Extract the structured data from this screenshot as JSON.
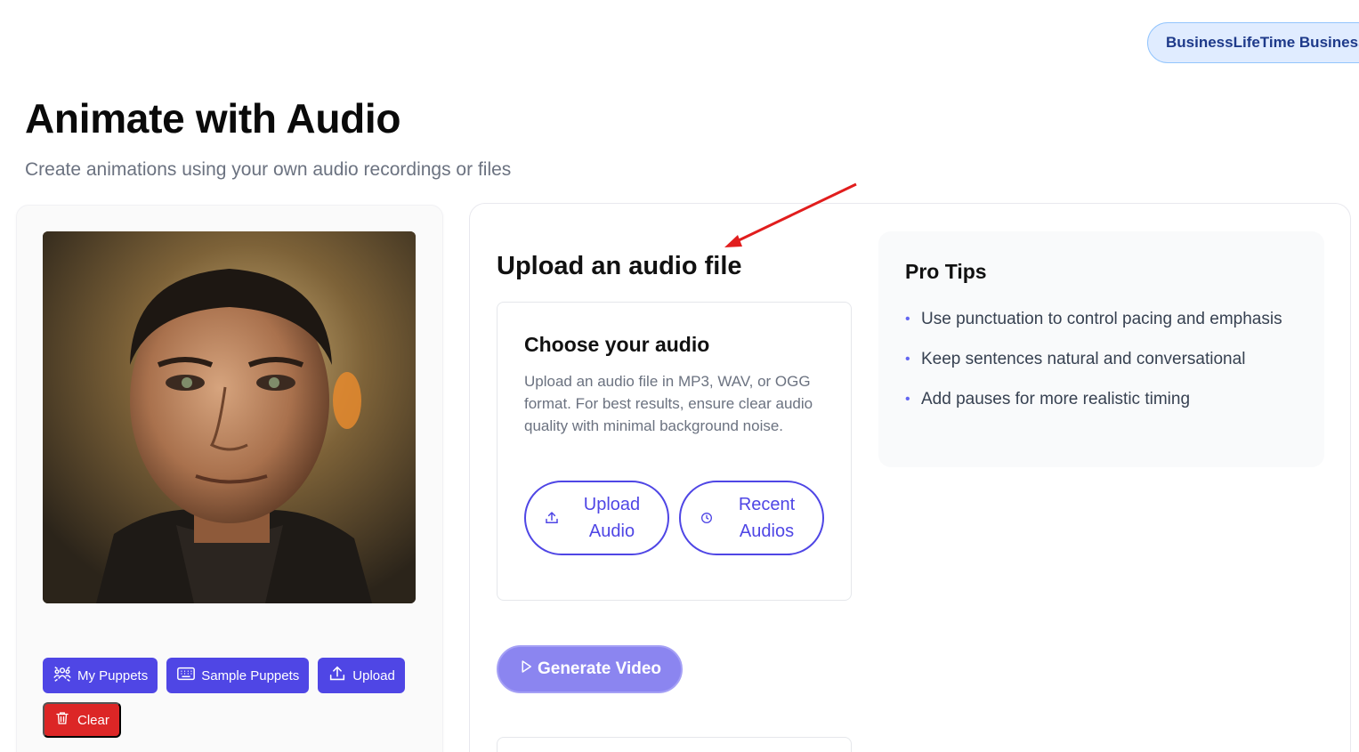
{
  "header": {
    "plan_badge": "BusinessLifeTime Business",
    "title": "Animate with Audio",
    "subtitle": "Create animations using your own audio recordings or files"
  },
  "left_panel": {
    "portrait_alt": "Puppet portrait",
    "buttons": {
      "my_puppets": "My Puppets",
      "sample_puppets": "Sample Puppets",
      "upload": "Upload",
      "clear": "Clear"
    }
  },
  "main": {
    "section_title": "Upload an audio file",
    "audio_box": {
      "title": "Choose your audio",
      "description": "Upload an audio file in MP3, WAV, or OGG format. For best results, ensure clear audio quality with minimal background noise.",
      "upload_audio_label": "Upload Audio",
      "recent_audios_label": "Recent Audios"
    },
    "generate_label": "Generate Video"
  },
  "tips": {
    "title": "Pro Tips",
    "items": [
      "Use punctuation to control pacing and emphasis",
      "Keep sentences natural and conversational",
      "Add pauses for more realistic timing"
    ]
  },
  "colors": {
    "accent": "#4f46e5",
    "danger": "#dc2626",
    "generate_disabled": "#8b85f0",
    "annotation": "#e11d1d"
  }
}
